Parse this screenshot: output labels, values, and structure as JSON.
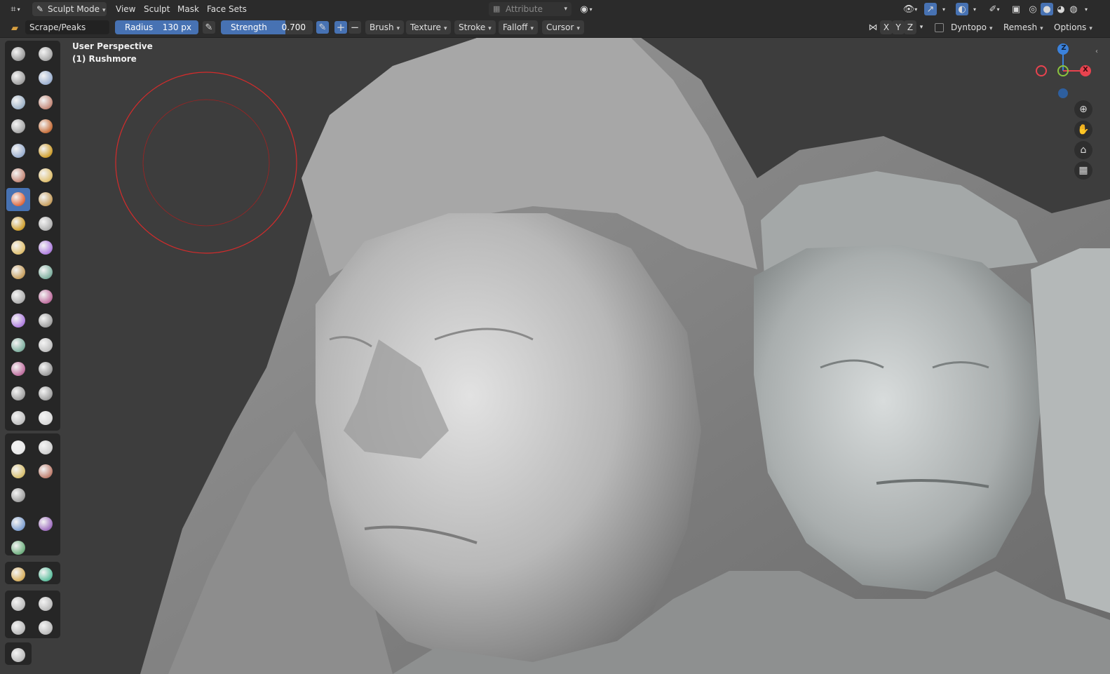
{
  "header": {
    "mode_label": "Sculpt Mode",
    "menus": [
      "View",
      "Sculpt",
      "Mask",
      "Face Sets"
    ],
    "attribute_label": "Attribute"
  },
  "tool_settings": {
    "brush_name": "Scrape/Peaks",
    "radius_label": "Radius",
    "radius_value": "130 px",
    "strength_label": "Strength",
    "strength_value": "0.700",
    "strength_fraction": 0.7,
    "plus": "+",
    "minus": "−",
    "dropdowns": [
      "Brush",
      "Texture",
      "Stroke",
      "Falloff",
      "Cursor"
    ],
    "axis_x": "X",
    "axis_y": "Y",
    "axis_z": "Z",
    "dyntopo_label": "Dyntopo",
    "remesh_label": "Remesh",
    "options_label": "Options"
  },
  "viewport": {
    "view_name": "User Perspective",
    "object_name": "(1) Rushmore"
  },
  "gizmo": {
    "z_label": "Z",
    "x_label": "X"
  },
  "colors": {
    "accent": "#4772b3",
    "header_bg": "#2b2b2b",
    "viewport_bg": "#3d3d3d",
    "brush_circle": "#d42b2b",
    "axis_x": "#e8434f",
    "axis_y": "#8bc43e",
    "axis_z": "#3b82dc"
  }
}
